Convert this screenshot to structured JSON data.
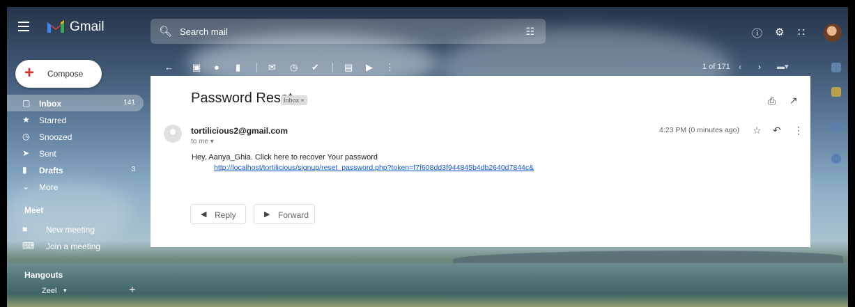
{
  "app": {
    "brand": "Gmail"
  },
  "search": {
    "placeholder": "Search mail"
  },
  "compose": {
    "label": "Compose"
  },
  "nav": [
    {
      "label": "Inbox",
      "count": "141",
      "icon": "inbox-icon"
    },
    {
      "label": "Starred",
      "count": "",
      "icon": "star-icon"
    },
    {
      "label": "Snoozed",
      "count": "",
      "icon": "clock-icon"
    },
    {
      "label": "Sent",
      "count": "",
      "icon": "send-icon"
    },
    {
      "label": "Drafts",
      "count": "3",
      "icon": "draft-icon"
    },
    {
      "label": "More",
      "count": "",
      "icon": "chevron-down-icon"
    }
  ],
  "meet": {
    "title": "Meet",
    "new_meeting": "New meeting",
    "join_meeting": "Join a meeting"
  },
  "hangouts": {
    "title": "Hangouts",
    "user": "Zeel"
  },
  "toolbar": {
    "pager": "1 of 171"
  },
  "email": {
    "subject": "Password Reset",
    "label": "Inbox ×",
    "sender": "tortilicious2@gmail.com",
    "to": "to me ▾",
    "time": "4:23 PM (0 minutes ago)",
    "body": "Hey, Aanya_Ghia. Click here to recover Your password",
    "link": "http://localhost/tortilicious/signup/reset_password.php?token=f7f608dd3f944845b4db2640d7844c&",
    "reply": "Reply",
    "forward": "Forward"
  },
  "colors": {
    "accent": "#d93025",
    "link": "#1155cc"
  }
}
